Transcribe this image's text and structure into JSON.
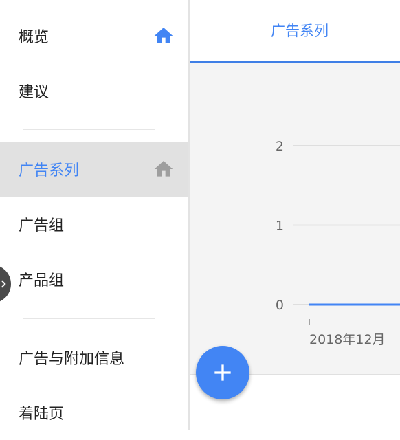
{
  "sidebar": {
    "items": [
      {
        "label": "概览",
        "icon": "home-icon"
      },
      {
        "label": "建议"
      },
      {
        "label": "广告系列",
        "icon": "home-icon",
        "selected": true
      },
      {
        "label": "广告组"
      },
      {
        "label": "产品组"
      },
      {
        "label": "广告与附加信息"
      },
      {
        "label": "着陆页"
      }
    ]
  },
  "main": {
    "tab": "广告系列",
    "chart_data": {
      "type": "line",
      "y_ticks": [
        "2",
        "1",
        "0"
      ],
      "ylim": [
        0,
        2
      ],
      "x_tick_labels": [
        "2018年12月"
      ],
      "series": [
        {
          "values": [
            0
          ]
        }
      ]
    }
  },
  "colors": {
    "accent": "#4285f4",
    "selected_bg": "#e1e1e1",
    "chart_bg": "#f4f4f4",
    "home_icon_selected_color": "#9e9e9e"
  },
  "fab": {
    "icon": "plus-icon"
  },
  "handle": {
    "icon": "chevron-right-icon"
  }
}
